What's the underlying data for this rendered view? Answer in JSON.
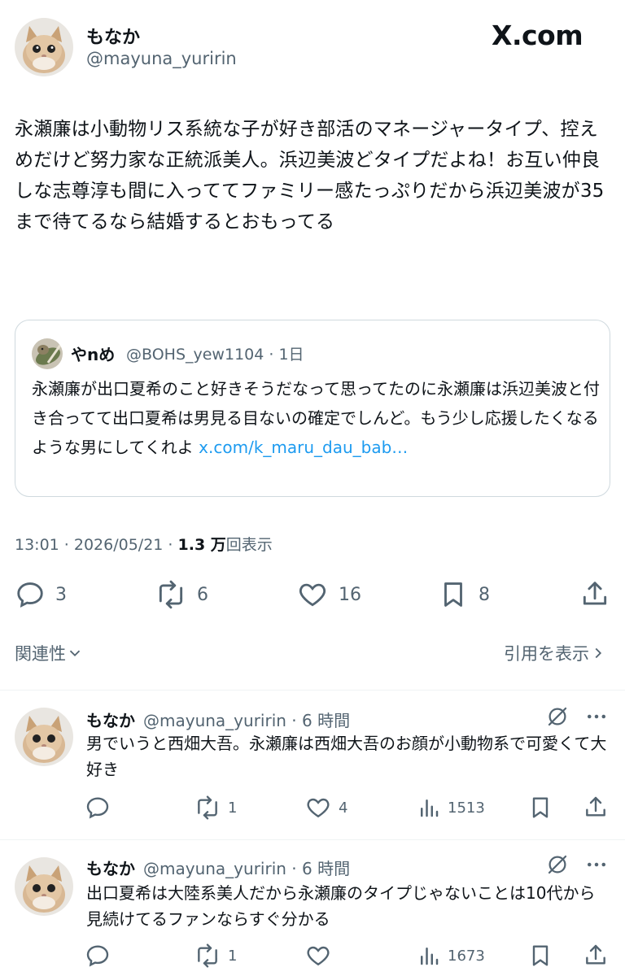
{
  "brand": "X.com",
  "main": {
    "author_name": "もなか",
    "author_handle": "@mayuna_yuririn",
    "text": "永瀬廉は小動物リス系統な子が好き部活のマネージャータイプ、控えめだけど努力家な正統派美人。浜辺美波どタイプだよね！お互い仲良しな志尊淳も間に入っててファミリー感たっぷりだから浜辺美波が35まで待てるなら結婚するとおもってる",
    "quote": {
      "name": "やnめ",
      "handle": "@BOHS_yew1104 · 1日",
      "text": "永瀬廉が出口夏希のこと好きそうだなって思ってたのに永瀬廉は浜辺美波と付き合ってて出口夏希は男見る目ないの確定でしんど。もう少し応援したくなるような男にしてくれよ ",
      "link": "x.com/k_maru_dau_bab…"
    },
    "time": "13:01 · 2026/05/21 · ",
    "views": "1.3 万",
    "views_label": "回表示",
    "actions": {
      "replies": "3",
      "reposts": "6",
      "likes": "16",
      "bookmarks": "8"
    },
    "tab_left": "関連性",
    "tab_right": "引用を表示"
  },
  "replies": [
    {
      "name": "もなか",
      "handle": "@mayuna_yuririn · 6 時間",
      "text": "男でいうと西畑大吾。永瀬廉は西畑大吾のお顔が小動物系で可愛くて大好き",
      "reposts": "1",
      "likes": "4",
      "views": "1513"
    },
    {
      "name": "もなか",
      "handle": "@mayuna_yuririn · 6 時間",
      "text": "出口夏希は大陸系美人だから永瀬廉のタイプじゃないことは10代から見続けてるファンならすぐ分かる",
      "reposts": "1",
      "likes": "",
      "views": "1673"
    }
  ]
}
